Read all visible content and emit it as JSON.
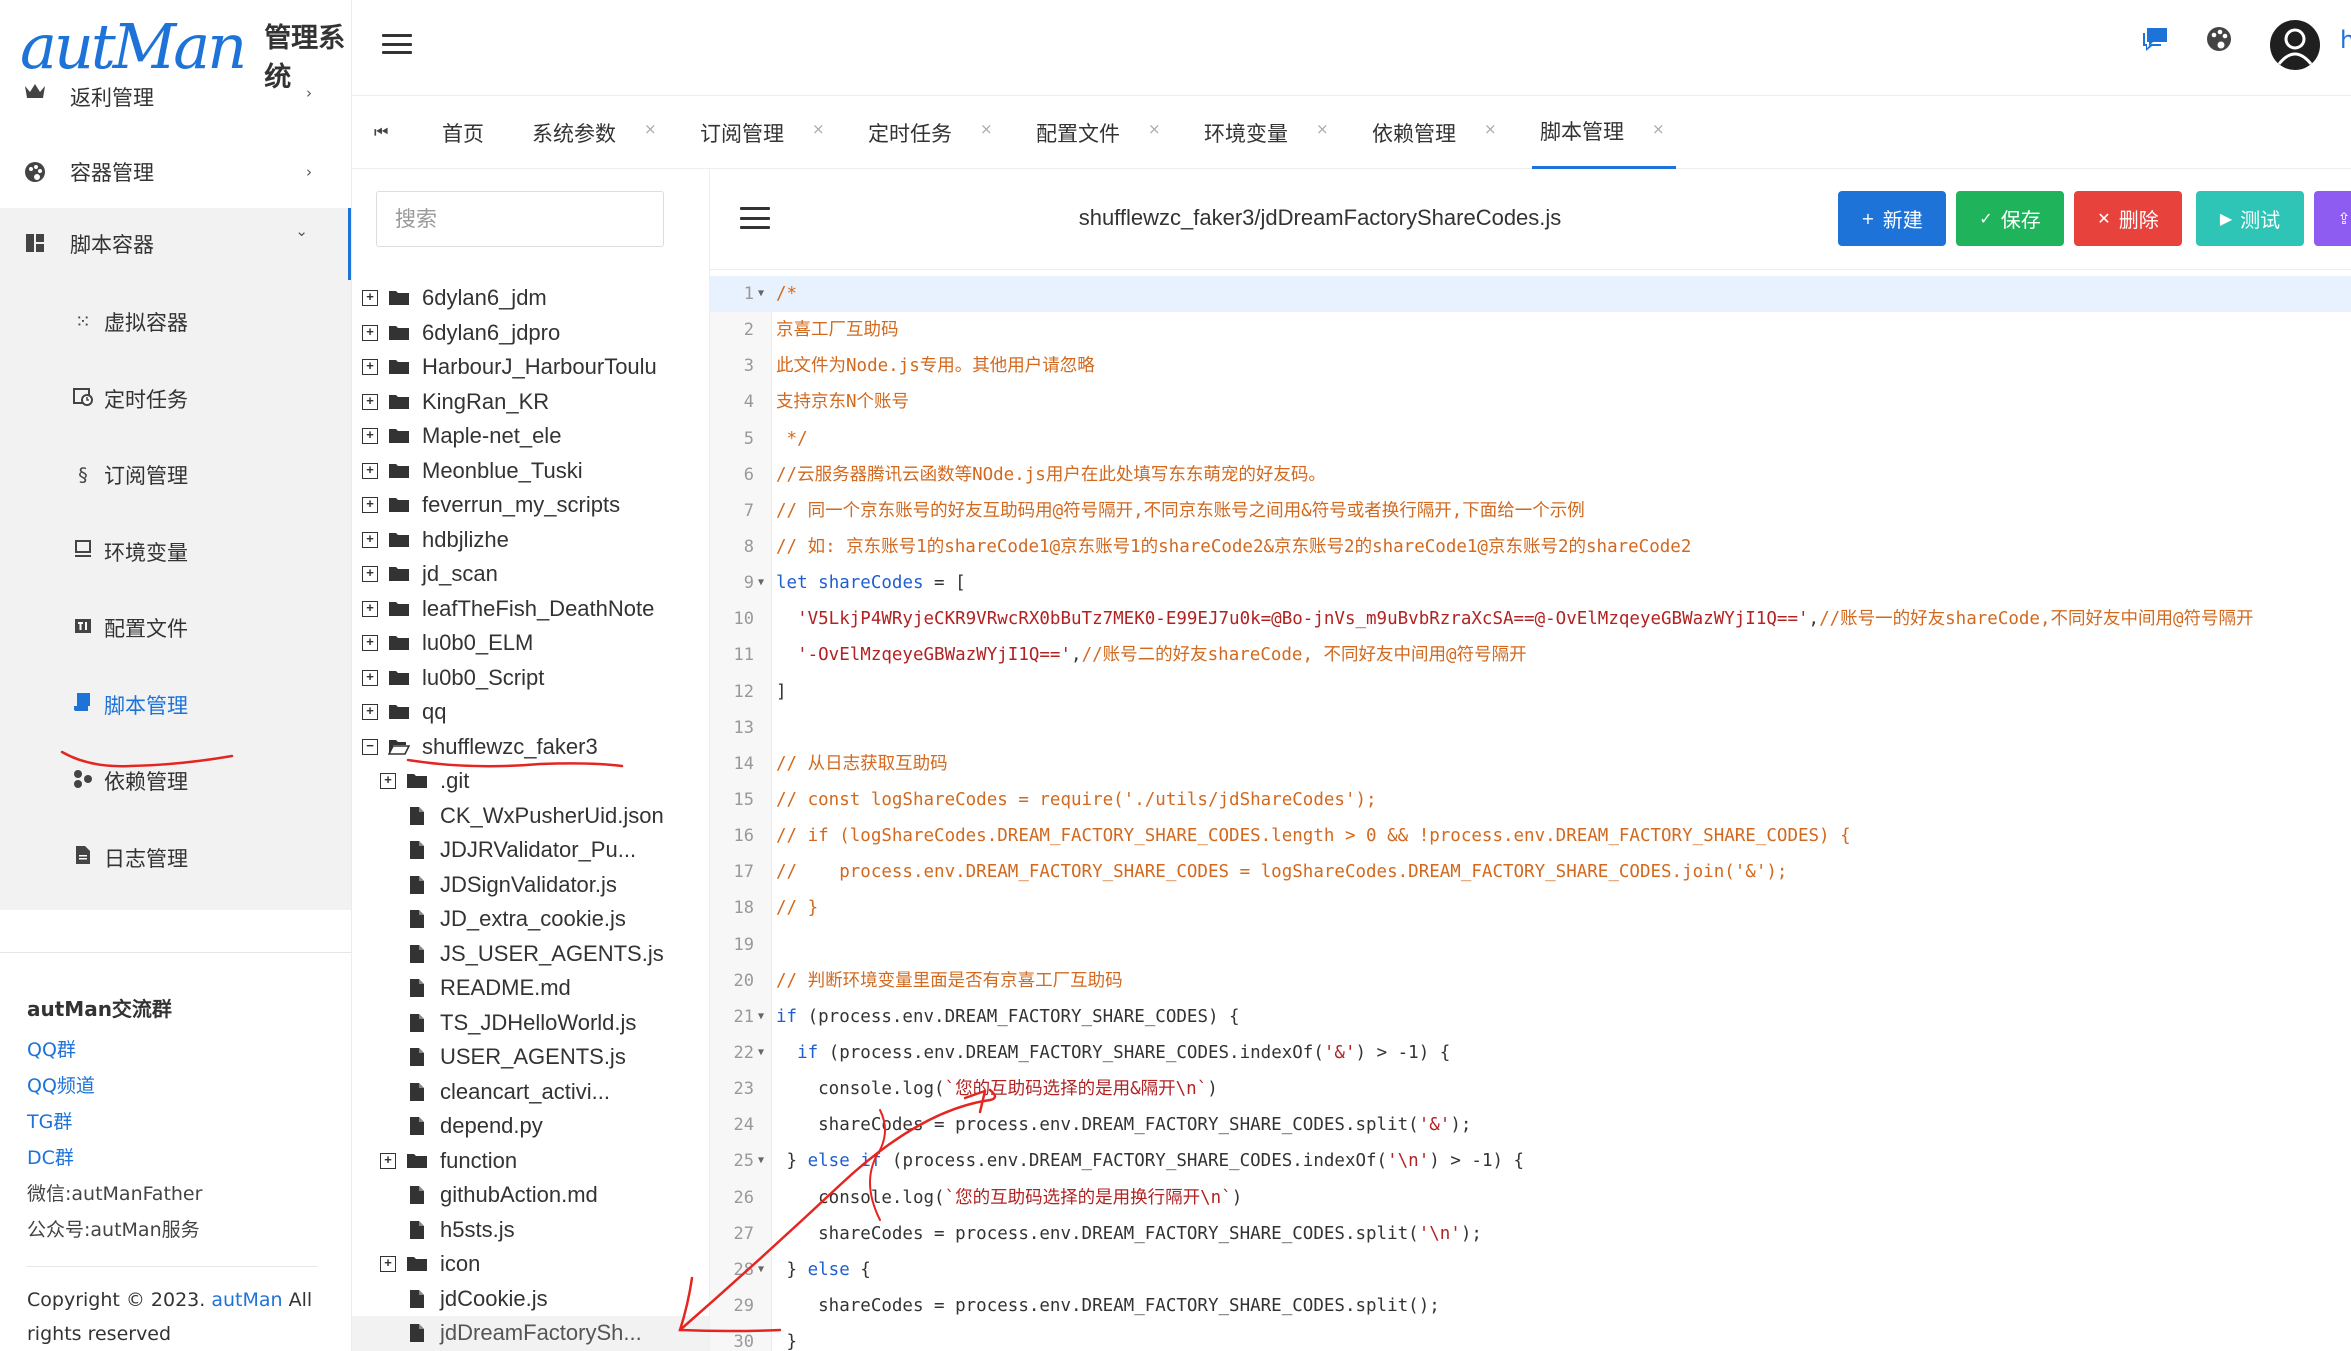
{
  "app": {
    "logo_text": "autMan",
    "title": "管理系统",
    "user_initial": "h"
  },
  "sidebar": {
    "items": [
      {
        "label": "返利管理",
        "icon": "crown-icon",
        "arrow": "›"
      },
      {
        "label": "容器管理",
        "icon": "palette-icon",
        "arrow": "›"
      },
      {
        "label": "脚本容器",
        "icon": "dashboard-icon",
        "arrow": "⌄"
      }
    ],
    "subitems": [
      {
        "label": "虚拟容器",
        "icon": "dots-icon"
      },
      {
        "label": "定时任务",
        "icon": "calendar-clock-icon"
      },
      {
        "label": "订阅管理",
        "icon": "section-icon"
      },
      {
        "label": "环境变量",
        "icon": "monitor-icon"
      },
      {
        "label": "配置文件",
        "icon": "tv-icon"
      },
      {
        "label": "脚本管理",
        "icon": "script-icon"
      },
      {
        "label": "依赖管理",
        "icon": "nodes-icon"
      },
      {
        "label": "日志管理",
        "icon": "file-icon"
      }
    ],
    "footer": {
      "title": "autMan交流群",
      "links": [
        "QQ群",
        "QQ频道",
        "TG群",
        "DC群"
      ],
      "texts": [
        "微信:autManFather",
        "公众号:autMan服务"
      ],
      "copyright_prefix": "Copyright © 2023.",
      "copyright_link": "autMan",
      "copyright_suffix": "All rights reserved"
    }
  },
  "tabs": [
    {
      "label": "首页",
      "closable": false
    },
    {
      "label": "系统参数",
      "closable": true
    },
    {
      "label": "订阅管理",
      "closable": true
    },
    {
      "label": "定时任务",
      "closable": true
    },
    {
      "label": "配置文件",
      "closable": true
    },
    {
      "label": "环境变量",
      "closable": true
    },
    {
      "label": "依赖管理",
      "closable": true
    },
    {
      "label": "脚本管理",
      "closable": true,
      "active": true
    }
  ],
  "tab_close_glyph": "×",
  "tree": {
    "search_placeholder": "搜索",
    "nodes": [
      {
        "label": "6dylan6_jdm",
        "type": "folder",
        "depth": 0,
        "expanded": false
      },
      {
        "label": "6dylan6_jdpro",
        "type": "folder",
        "depth": 0,
        "expanded": false
      },
      {
        "label": "HarbourJ_HarbourToulu",
        "type": "folder",
        "depth": 0,
        "expanded": false
      },
      {
        "label": "KingRan_KR",
        "type": "folder",
        "depth": 0,
        "expanded": false
      },
      {
        "label": "Maple-net_ele",
        "type": "folder",
        "depth": 0,
        "expanded": false
      },
      {
        "label": "Meonblue_Tuski",
        "type": "folder",
        "depth": 0,
        "expanded": false
      },
      {
        "label": "feverrun_my_scripts",
        "type": "folder",
        "depth": 0,
        "expanded": false
      },
      {
        "label": "hdbjlizhe",
        "type": "folder",
        "depth": 0,
        "expanded": false
      },
      {
        "label": "jd_scan",
        "type": "folder",
        "depth": 0,
        "expanded": false
      },
      {
        "label": "leafTheFish_DeathNote",
        "type": "folder",
        "depth": 0,
        "expanded": false
      },
      {
        "label": "lu0b0_ELM",
        "type": "folder",
        "depth": 0,
        "expanded": false
      },
      {
        "label": "lu0b0_Script",
        "type": "folder",
        "depth": 0,
        "expanded": false
      },
      {
        "label": "qq",
        "type": "folder",
        "depth": 0,
        "expanded": false
      },
      {
        "label": "shufflewzc_faker3",
        "type": "folder",
        "depth": 0,
        "expanded": true
      },
      {
        "label": ".git",
        "type": "folder",
        "depth": 1,
        "expanded": false
      },
      {
        "label": "CK_WxPusherUid.json",
        "type": "file",
        "depth": 1
      },
      {
        "label": "JDJRValidator_Pu...",
        "type": "file",
        "depth": 1
      },
      {
        "label": "JDSignValidator.js",
        "type": "file",
        "depth": 1
      },
      {
        "label": "JD_extra_cookie.js",
        "type": "file",
        "depth": 1
      },
      {
        "label": "JS_USER_AGENTS.js",
        "type": "file",
        "depth": 1
      },
      {
        "label": "README.md",
        "type": "file",
        "depth": 1
      },
      {
        "label": "TS_JDHelloWorld.js",
        "type": "file",
        "depth": 1
      },
      {
        "label": "USER_AGENTS.js",
        "type": "file",
        "depth": 1
      },
      {
        "label": "cleancart_activi...",
        "type": "file",
        "depth": 1
      },
      {
        "label": "depend.py",
        "type": "file",
        "depth": 1
      },
      {
        "label": "function",
        "type": "folder",
        "depth": 1,
        "expanded": false
      },
      {
        "label": "githubAction.md",
        "type": "file",
        "depth": 1
      },
      {
        "label": "h5sts.js",
        "type": "file",
        "depth": 1
      },
      {
        "label": "icon",
        "type": "folder",
        "depth": 1,
        "expanded": false
      },
      {
        "label": "jdCookie.js",
        "type": "file",
        "depth": 1
      },
      {
        "label": "jdDreamFactorySh...",
        "type": "file",
        "depth": 1,
        "selected": true
      }
    ]
  },
  "editor": {
    "file_path": "shufflewzc_faker3/jdDreamFactoryShareCodes.js",
    "buttons": [
      {
        "icon": "plus-icon",
        "glyph": "+",
        "label": "新建",
        "color": "#1e73d8"
      },
      {
        "icon": "check-icon",
        "glyph": "✓",
        "label": "保存",
        "color": "#1fb35b"
      },
      {
        "icon": "x-icon",
        "glyph": "✕",
        "label": "删除",
        "color": "#e8423c"
      },
      {
        "icon": "play-icon",
        "glyph": "▶",
        "label": "测试",
        "color": "#2ec4b6"
      },
      {
        "icon": "upload-icon",
        "glyph": "⇪",
        "label": "",
        "color": "#8e5cf0"
      }
    ],
    "lines": [
      {
        "n": "1",
        "fold": "▼",
        "segs": [
          {
            "t": "/*",
            "c": "comment"
          }
        ]
      },
      {
        "n": "2",
        "fold": "",
        "segs": [
          {
            "t": "京喜工厂互助码",
            "c": "comment"
          }
        ]
      },
      {
        "n": "3",
        "fold": "",
        "segs": [
          {
            "t": "此文件为Node.js专用。其他用户请忽略",
            "c": "comment"
          }
        ]
      },
      {
        "n": "4",
        "fold": "",
        "segs": [
          {
            "t": "支持京东N个账号",
            "c": "comment"
          }
        ]
      },
      {
        "n": "5",
        "fold": "",
        "segs": [
          {
            "t": " */",
            "c": "comment"
          }
        ]
      },
      {
        "n": "6",
        "fold": "",
        "segs": [
          {
            "t": "//云服务器腾讯云函数等NOde.js用户在此处填写东东萌宠的好友码。",
            "c": "comment"
          }
        ]
      },
      {
        "n": "7",
        "fold": "",
        "segs": [
          {
            "t": "// 同一个京东账号的好友互助码用@符号隔开,不同京东账号之间用&符号或者换行隔开,下面给一个示例",
            "c": "comment"
          }
        ]
      },
      {
        "n": "8",
        "fold": "",
        "segs": [
          {
            "t": "// 如: 京东账号1的shareCode1@京东账号1的shareCode2&京东账号2的shareCode1@京东账号2的shareCode2",
            "c": "comment"
          }
        ]
      },
      {
        "n": "9",
        "fold": "▼",
        "segs": [
          {
            "t": "let ",
            "c": "keyword"
          },
          {
            "t": "shareCodes",
            "c": "var"
          },
          {
            "t": " = [",
            "c": "plain"
          }
        ]
      },
      {
        "n": "10",
        "fold": "",
        "segs": [
          {
            "t": "  'V5LkjP4WRyjeCKR9VRwcRX0bBuTz7MEK0-E99EJ7u0k=@Bo-jnVs_m9uBvbRzraXcSA==@-OvElMzqeyeGBWazWYjI1Q=='",
            "c": "string"
          },
          {
            "t": ",",
            "c": "plain"
          },
          {
            "t": "//账号一的好友shareCode,不同好友中间用@符号隔开",
            "c": "comment"
          }
        ]
      },
      {
        "n": "11",
        "fold": "",
        "segs": [
          {
            "t": "  '-OvElMzqeyeGBWazWYjI1Q=='",
            "c": "string"
          },
          {
            "t": ",",
            "c": "plain"
          },
          {
            "t": "//账号二的好友shareCode, 不同好友中间用@符号隔开",
            "c": "comment"
          }
        ]
      },
      {
        "n": "12",
        "fold": "",
        "segs": [
          {
            "t": "]",
            "c": "plain"
          }
        ]
      },
      {
        "n": "13",
        "fold": "",
        "segs": []
      },
      {
        "n": "14",
        "fold": "",
        "segs": [
          {
            "t": "// 从日志获取互助码",
            "c": "comment"
          }
        ]
      },
      {
        "n": "15",
        "fold": "",
        "segs": [
          {
            "t": "// const logShareCodes = require('./utils/jdShareCodes');",
            "c": "comment"
          }
        ]
      },
      {
        "n": "16",
        "fold": "",
        "segs": [
          {
            "t": "// if (logShareCodes.DREAM_FACTORY_SHARE_CODES.length > 0 && !process.env.DREAM_FACTORY_SHARE_CODES) {",
            "c": "comment"
          }
        ]
      },
      {
        "n": "17",
        "fold": "",
        "segs": [
          {
            "t": "//    process.env.DREAM_FACTORY_SHARE_CODES = logShareCodes.DREAM_FACTORY_SHARE_CODES.join('&');",
            "c": "comment"
          }
        ]
      },
      {
        "n": "18",
        "fold": "",
        "segs": [
          {
            "t": "// }",
            "c": "comment"
          }
        ]
      },
      {
        "n": "19",
        "fold": "",
        "segs": []
      },
      {
        "n": "20",
        "fold": "",
        "segs": [
          {
            "t": "// 判断环境变量里面是否有京喜工厂互助码",
            "c": "comment"
          }
        ]
      },
      {
        "n": "21",
        "fold": "▼",
        "segs": [
          {
            "t": "if",
            "c": "keyword"
          },
          {
            "t": " (process.env.DREAM_FACTORY_SHARE_CODES) {",
            "c": "plain"
          }
        ]
      },
      {
        "n": "22",
        "fold": "▼",
        "segs": [
          {
            "t": "  ",
            "c": "plain"
          },
          {
            "t": "if",
            "c": "keyword"
          },
          {
            "t": " (process.env.DREAM_FACTORY_SHARE_CODES.indexOf(",
            "c": "plain"
          },
          {
            "t": "'&'",
            "c": "string"
          },
          {
            "t": ") > -1) {",
            "c": "plain"
          }
        ]
      },
      {
        "n": "23",
        "fold": "",
        "segs": [
          {
            "t": "    console.log(",
            "c": "plain"
          },
          {
            "t": "`您的互助码选择的是用&隔开\\n`",
            "c": "string"
          },
          {
            "t": ")",
            "c": "plain"
          }
        ]
      },
      {
        "n": "24",
        "fold": "",
        "segs": [
          {
            "t": "    shareCodes = process.env.DREAM_FACTORY_SHARE_CODES.split(",
            "c": "plain"
          },
          {
            "t": "'&'",
            "c": "string"
          },
          {
            "t": ");",
            "c": "plain"
          }
        ]
      },
      {
        "n": "25",
        "fold": "▼",
        "segs": [
          {
            "t": " } ",
            "c": "plain"
          },
          {
            "t": "else if",
            "c": "keyword"
          },
          {
            "t": " (process.env.DREAM_FACTORY_SHARE_CODES.indexOf(",
            "c": "plain"
          },
          {
            "t": "'\\n'",
            "c": "string"
          },
          {
            "t": ") > -1) {",
            "c": "plain"
          }
        ]
      },
      {
        "n": "26",
        "fold": "",
        "segs": [
          {
            "t": "    console.log(",
            "c": "plain"
          },
          {
            "t": "`您的互助码选择的是用换行隔开\\n`",
            "c": "string"
          },
          {
            "t": ")",
            "c": "plain"
          }
        ]
      },
      {
        "n": "27",
        "fold": "",
        "segs": [
          {
            "t": "    shareCodes = process.env.DREAM_FACTORY_SHARE_CODES.split(",
            "c": "plain"
          },
          {
            "t": "'\\n'",
            "c": "string"
          },
          {
            "t": ");",
            "c": "plain"
          }
        ]
      },
      {
        "n": "28",
        "fold": "▼",
        "segs": [
          {
            "t": " } ",
            "c": "plain"
          },
          {
            "t": "else",
            "c": "keyword"
          },
          {
            "t": " {",
            "c": "plain"
          }
        ]
      },
      {
        "n": "29",
        "fold": "",
        "segs": [
          {
            "t": "    shareCodes = process.env.DREAM_FACTORY_SHARE_CODES.split();",
            "c": "plain"
          }
        ]
      },
      {
        "n": "30",
        "fold": "",
        "segs": [
          {
            "t": " }",
            "c": "plain"
          }
        ]
      }
    ]
  },
  "colors": {
    "accent": "#1e73d8",
    "comment": "#d2691e",
    "string": "#b22222",
    "keyword": "#1f5fd1",
    "var": "#1f5fd1",
    "plain": "#333333",
    "annotation": "#e52521"
  }
}
